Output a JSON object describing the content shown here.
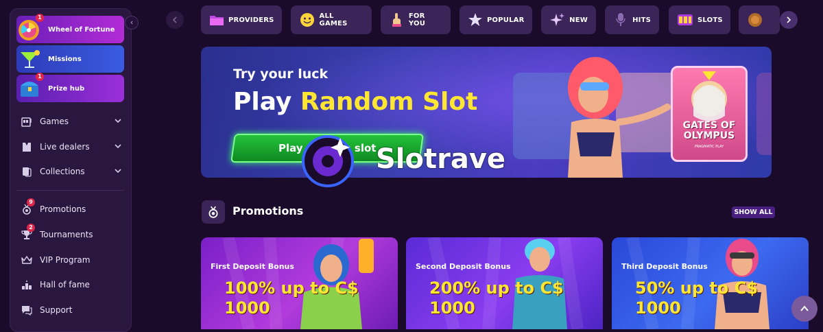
{
  "sidebar": {
    "promo_cards": [
      {
        "label": "Wheel of Fortune",
        "badge": "1",
        "icon": "wheel-icon"
      },
      {
        "label": "Missions",
        "icon": "cocktail-icon"
      },
      {
        "label": "Prize hub",
        "badge": "1",
        "icon": "treasure-chest-icon"
      }
    ],
    "nav": [
      {
        "label": "Games",
        "icon": "slot-machine-icon",
        "expandable": true
      },
      {
        "label": "Live dealers",
        "icon": "tuxedo-icon",
        "expandable": true
      },
      {
        "label": "Collections",
        "icon": "cards-icon",
        "expandable": true
      },
      {
        "label": "Promotions",
        "icon": "medal-icon",
        "badge": "9"
      },
      {
        "label": "Tournaments",
        "icon": "trophy-icon",
        "badge": "2"
      },
      {
        "label": "VIP Program",
        "icon": "crown-icon"
      },
      {
        "label": "Hall of fame",
        "icon": "podium-icon"
      },
      {
        "label": "Support",
        "icon": "chat-icon"
      }
    ]
  },
  "categories": [
    {
      "label": "PROVIDERS",
      "icon": "folder-icon"
    },
    {
      "label": "ALL GAMES",
      "icon": "smiley-icon"
    },
    {
      "label": "FOR YOU",
      "icon": "pointing-hand-icon"
    },
    {
      "label": "POPULAR",
      "icon": "star-icon"
    },
    {
      "label": "NEW",
      "icon": "sparkle-icon"
    },
    {
      "label": "HITS",
      "icon": "microphone-icon"
    },
    {
      "label": "SLOTS",
      "icon": "slot-reels-icon"
    }
  ],
  "hero": {
    "subtitle": "Try your luck",
    "title_prefix": "Play ",
    "title_highlight": "Random Slot",
    "button_label": "Play random slot",
    "tile_gates_title": "GATES OF OLYMPUS",
    "tile_gates_provider": "PRAGMATIC PLAY"
  },
  "logo": "Slotrave",
  "promotions": {
    "title": "Promotions",
    "show_all": "SHOW ALL",
    "cards": [
      {
        "label": "First Deposit Bonus",
        "amount_line1": "100% up to C$",
        "amount_line2": "1000"
      },
      {
        "label": "Second Deposit Bonus",
        "amount_line1": "200% up to C$",
        "amount_line2": "1000"
      },
      {
        "label": "Third Deposit Bonus",
        "amount_line1": "50% up to C$",
        "amount_line2": "1000"
      }
    ]
  },
  "colors": {
    "background": "#1a0b2b",
    "sidebar": "#2a1740",
    "highlight_yellow": "#ffe633",
    "play_green": "#1fae34",
    "badge_red": "#e1264a"
  }
}
